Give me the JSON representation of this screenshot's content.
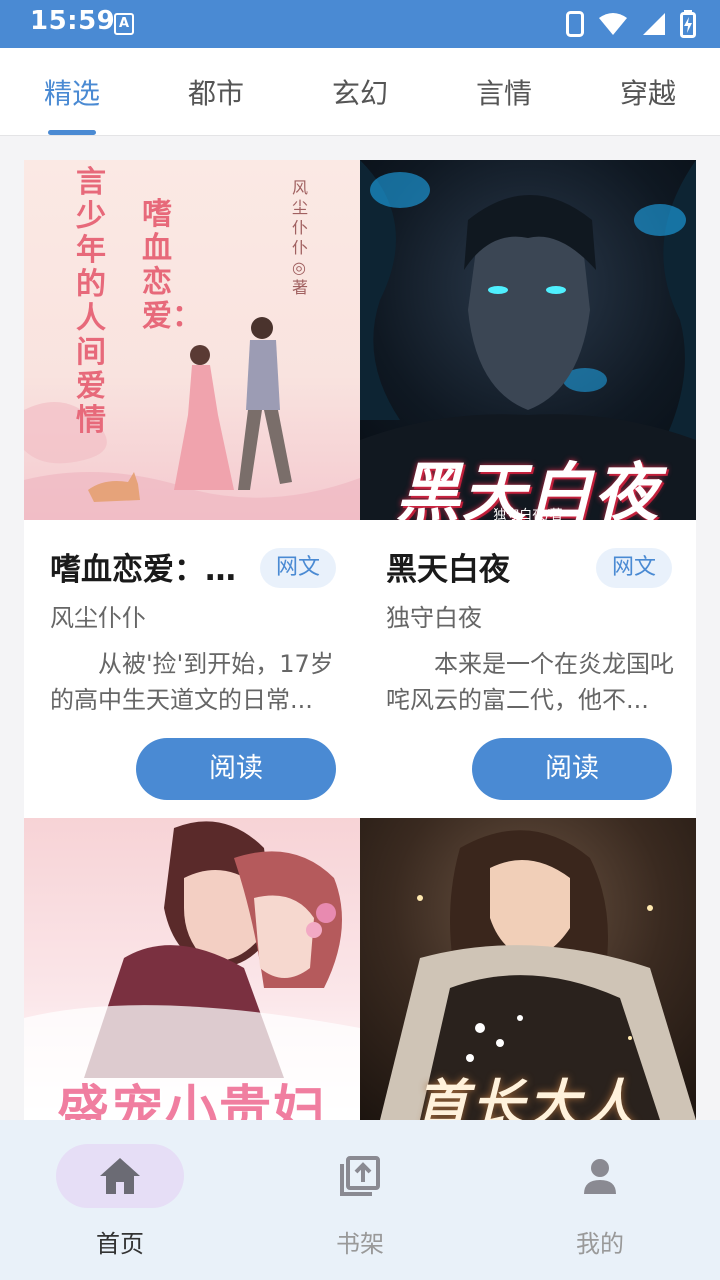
{
  "status_bar": {
    "time": "15:59",
    "notification_letter": "A"
  },
  "tabs": [
    {
      "label": "精选",
      "active": true
    },
    {
      "label": "都市",
      "active": false
    },
    {
      "label": "玄幻",
      "active": false
    },
    {
      "label": "言情",
      "active": false
    },
    {
      "label": "穿越",
      "active": false
    }
  ],
  "books": [
    {
      "title": "嗜血恋爱：...",
      "tag": "网文",
      "author": "风尘仆仆",
      "description": "从被'捡'到开始，17岁的高中生天道文的日常...",
      "read_label": "阅读",
      "cover_text": "嗜血恋爱：言少年的人间爱情",
      "cover_author": "风尘仆仆◎著"
    },
    {
      "title": "黑天白夜",
      "tag": "网文",
      "author": "独守白夜",
      "description": "本来是一个在炎龙国叱咤风云的富二代，他不...",
      "read_label": "阅读",
      "cover_text": "黑天白夜",
      "cover_author": "独守白夜/著"
    },
    {
      "cover_text": "盛宠小贵妇"
    },
    {
      "cover_text": "首长大人"
    }
  ],
  "bottom_nav": [
    {
      "label": "首页",
      "icon": "home-icon",
      "active": true
    },
    {
      "label": "书架",
      "icon": "bookshelf-icon",
      "active": false
    },
    {
      "label": "我的",
      "icon": "person-icon",
      "active": false
    }
  ],
  "colors": {
    "accent": "#4a8ad3",
    "tag_bg": "#e9f1fb",
    "nav_bg": "#e9f1f9",
    "nav_pill": "#e6def6"
  }
}
